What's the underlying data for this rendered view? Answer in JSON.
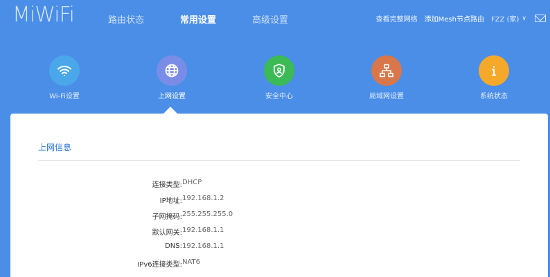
{
  "brand": {
    "logo": "MiWiFi"
  },
  "nav": {
    "items": [
      {
        "label": "路由状态",
        "active": false
      },
      {
        "label": "常用设置",
        "active": true
      },
      {
        "label": "高级设置",
        "active": false
      }
    ]
  },
  "header": {
    "view_full_network": "查看完整网络",
    "add_mesh": "添加Mesh节点路由",
    "user": "FZZ (家)"
  },
  "menu": {
    "items": [
      {
        "label": "Wi-Fi设置",
        "icon": "wifi-icon",
        "color": "#4aa7ea"
      },
      {
        "label": "上网设置",
        "icon": "globe-icon",
        "color": "#7a8de6"
      },
      {
        "label": "安全中心",
        "icon": "shield-user-icon",
        "color": "#3cba56"
      },
      {
        "label": "局域网设置",
        "icon": "network-icon",
        "color": "#d9764a"
      },
      {
        "label": "系统状态",
        "icon": "info-icon",
        "color": "#f5a82a"
      }
    ]
  },
  "panel": {
    "title": "上网信息",
    "rows": [
      {
        "label": "连接类型:",
        "value": "DHCP"
      },
      {
        "label": "IP地址:",
        "value": "192.168.1.2"
      },
      {
        "label": "子网掩码:",
        "value": "255.255.255.0"
      },
      {
        "label": "默认网关:",
        "value": "192.168.1.1"
      },
      {
        "label": "DNS:",
        "value": "192.168.1.1"
      },
      {
        "label": "IPv6连接类型:",
        "value": "NAT6"
      }
    ]
  }
}
